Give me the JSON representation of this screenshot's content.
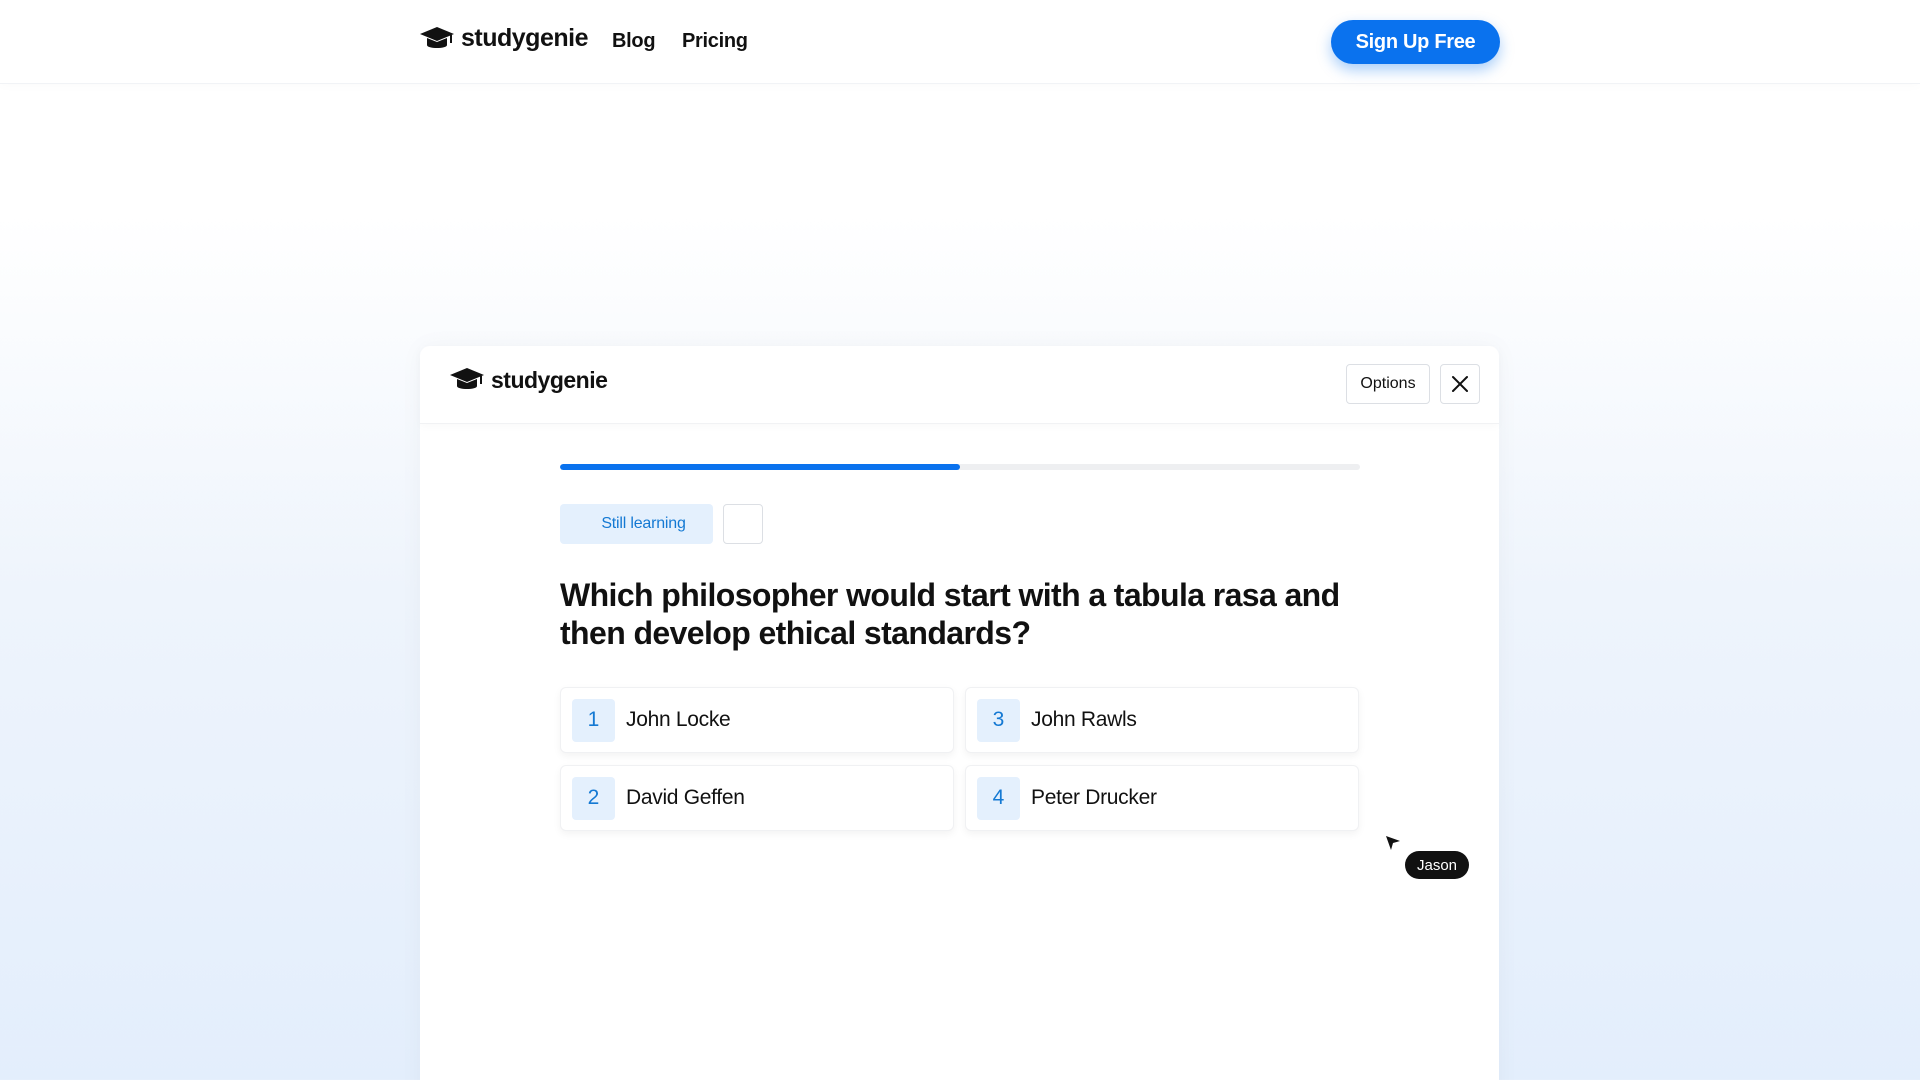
{
  "nav": {
    "brand": "studygenie",
    "links": [
      "Blog",
      "Pricing"
    ],
    "signup_label": "Sign Up Free",
    "accent": "#0a72ee"
  },
  "modal": {
    "brand": "studygenie",
    "options_label": "Options",
    "close_icon": "close-icon",
    "progress_fraction": 0.5,
    "status_badge": "Still learning",
    "question": "Which philosopher would start with a tabula rasa and then develop ethical standards?",
    "answers": [
      {
        "num": "1",
        "label": "John Locke"
      },
      {
        "num": "2",
        "label": "David Geffen"
      },
      {
        "num": "3",
        "label": "John Rawls"
      },
      {
        "num": "4",
        "label": "Peter Drucker"
      }
    ]
  },
  "collaborator": {
    "name": "Jason"
  }
}
